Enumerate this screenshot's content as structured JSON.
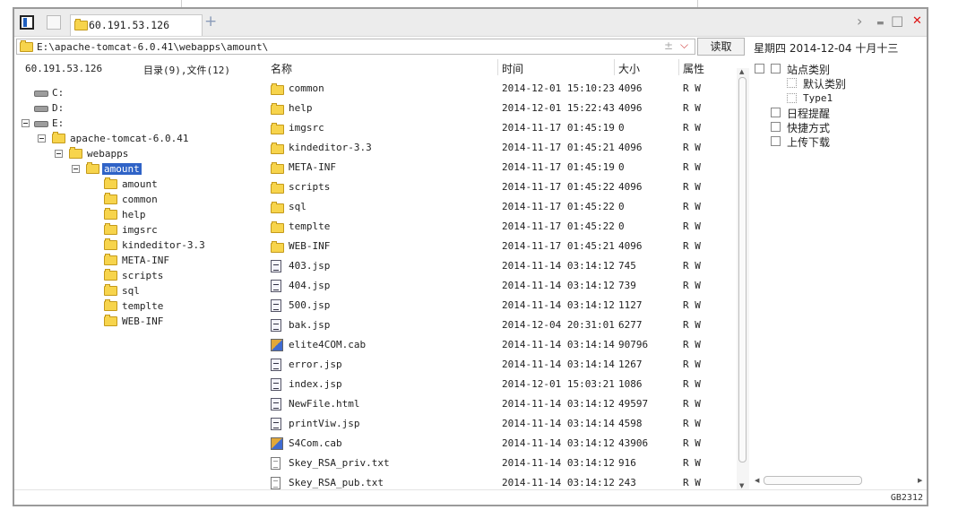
{
  "tab": {
    "title": "60.191.53.126",
    "new_tab": "+"
  },
  "window_controls": {
    "nav": "›",
    "minimize": "▬",
    "maximize": "□",
    "close": "✕"
  },
  "address": {
    "path": "E:\\apache-tomcat-6.0.41\\webapps\\amount\\",
    "pm": "±",
    "dropdown": "⌵",
    "read_button": "读取"
  },
  "datebar": {
    "text": "星期四 2014-12-04 十月十三"
  },
  "left_panel": {
    "host": "60.191.53.126",
    "summary": "目录(9),文件(12)",
    "drives": [
      "C:",
      "D:",
      "E:"
    ],
    "tree": {
      "tomcat": "apache-tomcat-6.0.41",
      "webapps": "webapps",
      "amount": "amount",
      "children": [
        "amount",
        "common",
        "help",
        "imgsrc",
        "kindeditor-3.3",
        "META-INF",
        "scripts",
        "sql",
        "templte",
        "WEB-INF"
      ]
    }
  },
  "file_list": {
    "columns": {
      "name": "名称",
      "time": "时间",
      "size": "大小",
      "attr": "属性"
    },
    "rows": [
      {
        "icon": "folder",
        "name": "common",
        "time": "2014-12-01 15:10:23",
        "size": "4096",
        "attr": "R W"
      },
      {
        "icon": "folder",
        "name": "help",
        "time": "2014-12-01 15:22:43",
        "size": "4096",
        "attr": "R W"
      },
      {
        "icon": "folder",
        "name": "imgsrc",
        "time": "2014-11-17 01:45:19",
        "size": "0",
        "attr": "R W"
      },
      {
        "icon": "folder",
        "name": "kindeditor-3.3",
        "time": "2014-11-17 01:45:21",
        "size": "4096",
        "attr": "R W"
      },
      {
        "icon": "folder",
        "name": "META-INF",
        "time": "2014-11-17 01:45:19",
        "size": "0",
        "attr": "R W"
      },
      {
        "icon": "folder",
        "name": "scripts",
        "time": "2014-11-17 01:45:22",
        "size": "4096",
        "attr": "R W"
      },
      {
        "icon": "folder",
        "name": "sql",
        "time": "2014-11-17 01:45:22",
        "size": "0",
        "attr": "R W"
      },
      {
        "icon": "folder",
        "name": "templte",
        "time": "2014-11-17 01:45:22",
        "size": "0",
        "attr": "R W"
      },
      {
        "icon": "folder",
        "name": "WEB-INF",
        "time": "2014-11-17 01:45:21",
        "size": "4096",
        "attr": "R W"
      },
      {
        "icon": "doc",
        "name": "403.jsp",
        "time": "2014-11-14 03:14:12",
        "size": "745",
        "attr": "R W"
      },
      {
        "icon": "doc",
        "name": "404.jsp",
        "time": "2014-11-14 03:14:12",
        "size": "739",
        "attr": "R W"
      },
      {
        "icon": "doc",
        "name": "500.jsp",
        "time": "2014-11-14 03:14:12",
        "size": "1127",
        "attr": "R W"
      },
      {
        "icon": "doc",
        "name": "bak.jsp",
        "time": "2014-12-04 20:31:01",
        "size": "6277",
        "attr": "R W"
      },
      {
        "icon": "cab",
        "name": "elite4COM.cab",
        "time": "2014-11-14 03:14:14",
        "size": "90796",
        "attr": "R W"
      },
      {
        "icon": "doc",
        "name": "error.jsp",
        "time": "2014-11-14 03:14:14",
        "size": "1267",
        "attr": "R W"
      },
      {
        "icon": "doc",
        "name": "index.jsp",
        "time": "2014-12-01 15:03:21",
        "size": "1086",
        "attr": "R W"
      },
      {
        "icon": "doc",
        "name": "NewFile.html",
        "time": "2014-11-14 03:14:12",
        "size": "49597",
        "attr": "R W"
      },
      {
        "icon": "doc",
        "name": "printViw.jsp",
        "time": "2014-11-14 03:14:14",
        "size": "4598",
        "attr": "R W"
      },
      {
        "icon": "cab",
        "name": "S4Com.cab",
        "time": "2014-11-14 03:14:12",
        "size": "43906",
        "attr": "R W"
      },
      {
        "icon": "txt",
        "name": "Skey_RSA_priv.txt",
        "time": "2014-11-14 03:14:12",
        "size": "916",
        "attr": "R W"
      },
      {
        "icon": "txt",
        "name": "Skey_RSA_pub.txt",
        "time": "2014-11-14 03:14:12",
        "size": "243",
        "attr": "R W"
      }
    ]
  },
  "right_panel": {
    "site_category": "站点类别",
    "default_category": "默认类别",
    "type1": "Type1",
    "schedule": "日程提醒",
    "shortcuts": "快捷方式",
    "upload_download": "上传下载"
  },
  "status": {
    "encoding": "GB2312"
  }
}
